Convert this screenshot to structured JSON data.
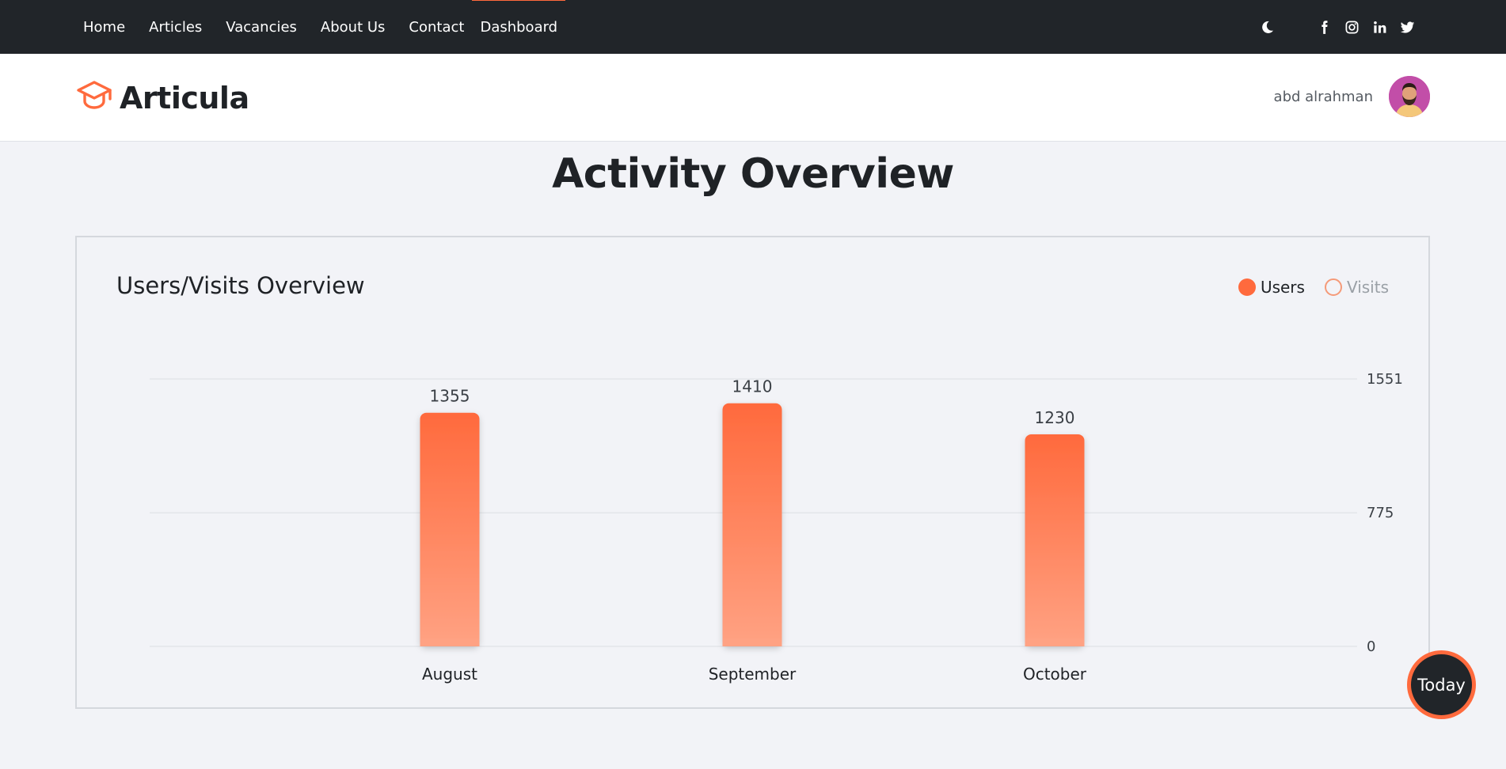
{
  "nav": {
    "links": [
      "Home",
      "Articles",
      "Vacancies",
      "About Us",
      "Contact",
      "Dashboard"
    ],
    "active": "Dashboard",
    "icons": [
      "moon-icon",
      "facebook-icon",
      "instagram-icon",
      "linkedin-icon",
      "twitter-icon"
    ]
  },
  "brand": {
    "name": "Articula",
    "logo_icon": "graduation-cap-icon",
    "accent": "#ff6a3d"
  },
  "user": {
    "name": "abd alrahman"
  },
  "page": {
    "title": "Activity Overview"
  },
  "card": {
    "title": "Users/Visits Overview"
  },
  "legend": {
    "users": "Users",
    "visits": "Visits"
  },
  "today_button": "Today",
  "colors": {
    "accent": "#ff6a3d",
    "nav_bg": "#212529",
    "page_bg": "#f2f3f7"
  },
  "chart_data": {
    "type": "bar",
    "categories": [
      "August",
      "September",
      "October"
    ],
    "series": [
      {
        "name": "Users",
        "values": [
          1355,
          1410,
          1230
        ]
      }
    ],
    "hidden_series": [
      "Visits"
    ],
    "title": "Users/Visits Overview",
    "y_ticks": [
      0,
      775,
      1551
    ],
    "ylim": [
      0,
      1551
    ],
    "grid": true,
    "legend_position": "top-right",
    "y_axis_side": "right"
  }
}
